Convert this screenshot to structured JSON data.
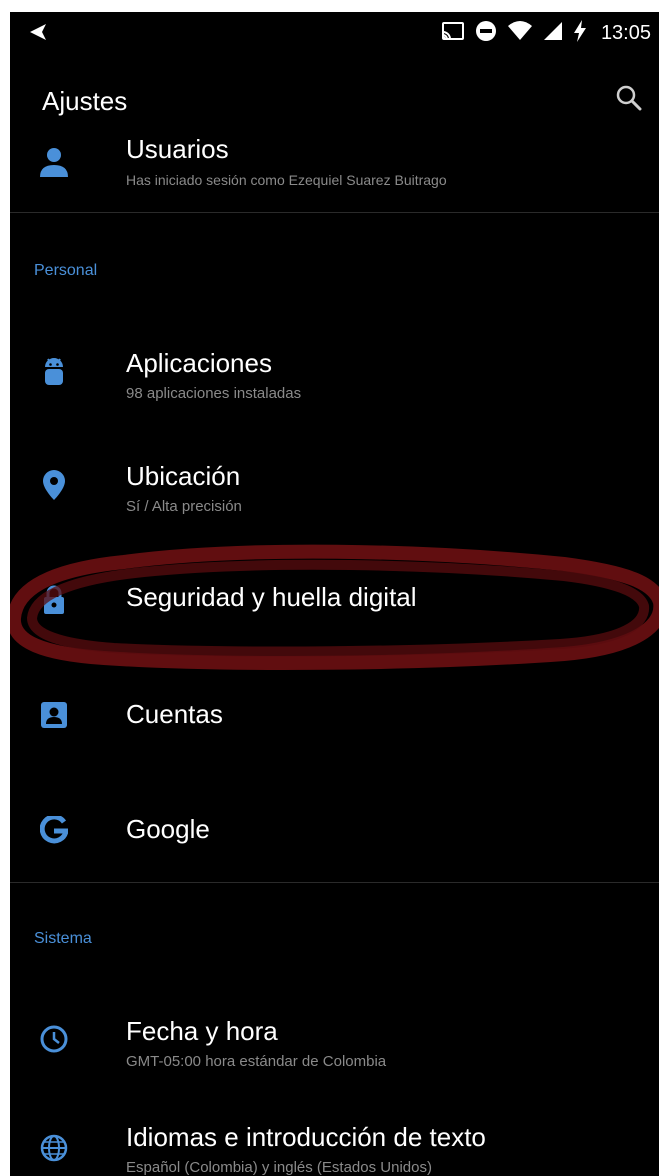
{
  "status_bar": {
    "time": "13:05",
    "icons": [
      "back-arrow-icon",
      "cast-icon",
      "do-not-disturb-icon",
      "wifi-icon",
      "cellular-signal-icon",
      "charging-bolt-icon"
    ]
  },
  "app_bar": {
    "title": "Ajustes",
    "search_icon": "search-icon"
  },
  "accent_color": "#4a90d9",
  "highlight_color": "#6b0f12",
  "top_item": {
    "label": "Usuarios",
    "sublabel": "Has iniciado sesión como Ezequiel Suarez Buitrago",
    "icon": "person-icon"
  },
  "sections": [
    {
      "title": "Personal",
      "items": [
        {
          "label": "Aplicaciones",
          "sublabel": "98 aplicaciones instaladas",
          "icon": "android-icon"
        },
        {
          "label": "Ubicación",
          "sublabel": "Sí / Alta precisión",
          "icon": "location-pin-icon"
        },
        {
          "label": "Seguridad y huella digital",
          "sublabel": "",
          "icon": "lock-icon"
        },
        {
          "label": "Cuentas",
          "sublabel": "",
          "icon": "account-box-icon"
        },
        {
          "label": "Google",
          "sublabel": "",
          "icon": "google-g-icon"
        }
      ]
    },
    {
      "title": "Sistema",
      "items": [
        {
          "label": "Fecha y hora",
          "sublabel": "GMT-05:00 hora estándar de Colombia",
          "icon": "clock-icon"
        },
        {
          "label": "Idiomas e introducción de texto",
          "sublabel": "Español (Colombia) y inglés (Estados Unidos)",
          "icon": "globe-icon"
        }
      ]
    }
  ]
}
